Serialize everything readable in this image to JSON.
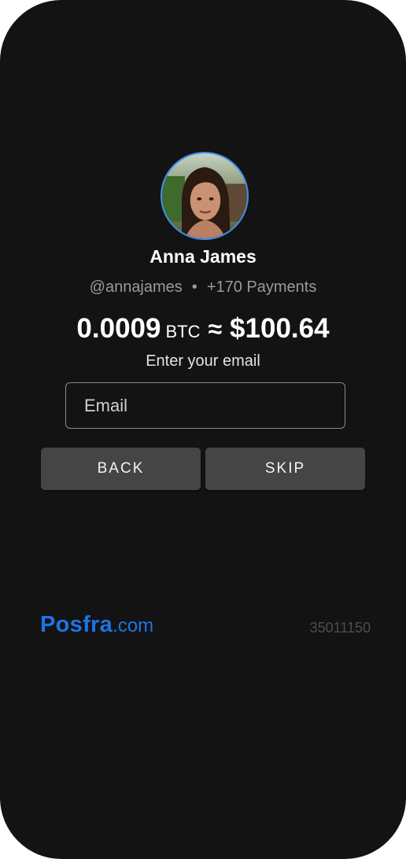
{
  "profile": {
    "name": "Anna James",
    "handle": "@annajames",
    "separator": "•",
    "payments": "+170 Payments"
  },
  "amount": {
    "crypto_value": "0.0009",
    "crypto_unit": "BTC",
    "approx_symbol": "≈",
    "fiat_value": "$100.64"
  },
  "form": {
    "prompt": "Enter your email",
    "email_placeholder": "Email",
    "email_value": ""
  },
  "buttons": {
    "back_label": "BACK",
    "skip_label": "SKIP"
  },
  "footer": {
    "brand_main": "Posfra",
    "brand_tld": ".com",
    "code": "35011150"
  },
  "colors": {
    "background": "#131313",
    "accent": "#1f73e6",
    "avatar_ring": "#3d8ef0",
    "button_bg": "#454545"
  },
  "icons": {
    "avatar": "profile-photo"
  }
}
